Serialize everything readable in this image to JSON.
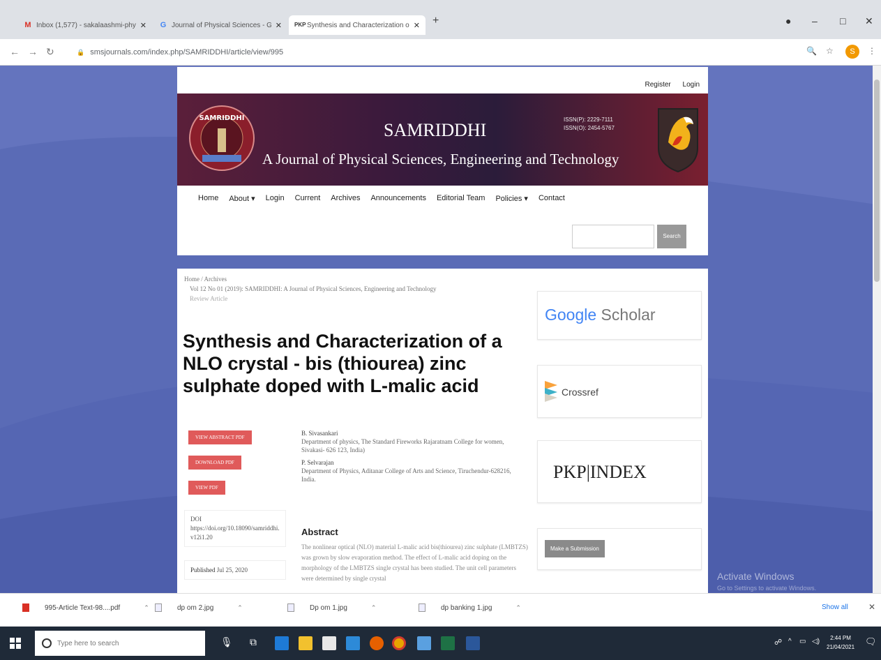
{
  "tabs": [
    {
      "title": "Inbox (1,577) - sakalaashmi-phy...",
      "icon": "gmail-icon"
    },
    {
      "title": "Journal of Physical Sciences - G...",
      "icon": "google-icon"
    },
    {
      "title": "Synthesis and Characterization o...",
      "icon": "pkp-icon"
    }
  ],
  "address": {
    "url": "smsjournals.com/index.php/SAMRIDDHI/article/view/995",
    "profile_initial": "S"
  },
  "header": {
    "register": "Register",
    "login": "Login",
    "journal_title": "SAMRIDDHI",
    "journal_subtitle": "A Journal of Physical Sciences, Engineering and Technology",
    "issn_print": "ISSN(P): 2229-7111",
    "issn_online": "ISSN(O): 2454-5767",
    "seal_text": "SAMRIDDHI"
  },
  "nav": [
    "Home",
    "About ▾",
    "Login",
    "Current",
    "Archives",
    "Announcements",
    "Editorial Team",
    "Policies ▾",
    "Contact"
  ],
  "search": {
    "button": "Search",
    "value": ""
  },
  "breadcrumb": {
    "home": "Home",
    "archives": "Archives",
    "issue": "Vol 12 No 01 (2019): SAMRIDDHI: A Journal of Physical Sciences, Engineering and Technology",
    "section": "Review Article"
  },
  "article": {
    "title": "Synthesis and Characterization of a NLO crystal - bis (thiourea) zinc sulphate doped with L-malic acid",
    "buttons": [
      "VIEW ABSTRACT PDF",
      "DOWNLOAD PDF",
      "VIEW PDF"
    ],
    "doi_label": "DOI",
    "doi": "https://doi.org/10.18090/samriddhi.v12i1.20",
    "published_label": "Published",
    "published": "Jul 25, 2020",
    "authors": [
      {
        "name": "B. Sivasankari",
        "aff": "Department of physics, The Standard Fireworks Rajaratnam College for women, Sivakasi- 626 123, India)"
      },
      {
        "name": "P. Selvarajan",
        "aff": "Department of Physics, Aditanar College of Arts and Science, Tiruchendur-628216, India."
      }
    ],
    "abstract_heading": "Abstract",
    "abstract": "The nonlinear optical (NLO) material L-malic acid bis(thiourea) zinc sulphate (LMBTZS) was grown by slow evaporation method. The effect of L-malic acid doping on the morphology of the LMBTZS single crystal has been studied. The unit cell parameters were determined by single crystal"
  },
  "sidebar": {
    "google_scholar_1": "Google",
    "google_scholar_2": " Scholar",
    "crossref": "Crossref",
    "pkp": "PKP|INDEX",
    "submit": "Make a Submission"
  },
  "downloads": [
    {
      "name": "995-Article Text-98....pdf"
    },
    {
      "name": "dp om 2.jpg"
    },
    {
      "name": "Dp om 1.jpg"
    },
    {
      "name": "dp banking 1.jpg"
    }
  ],
  "download_show_all": "Show all",
  "taskbar": {
    "search": "Type here to search",
    "time": "2:44 PM",
    "date": "21/04/2021"
  },
  "watermark": {
    "line1": "Activate Windows",
    "line2": "Go to Settings to activate Windows."
  }
}
